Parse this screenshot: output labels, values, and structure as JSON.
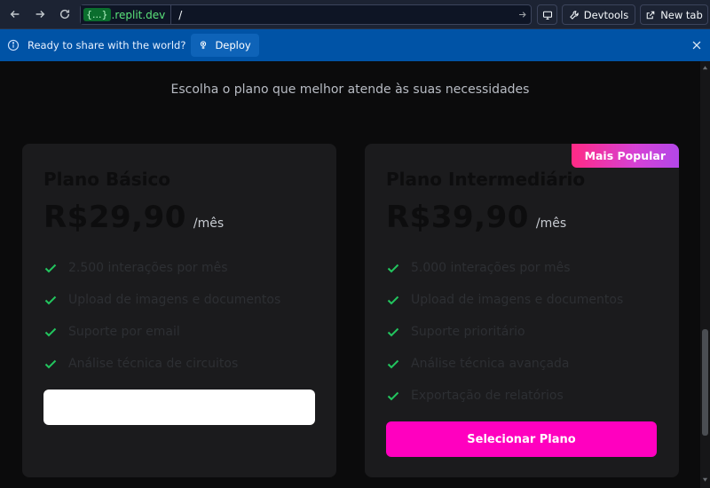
{
  "browser": {
    "url_badge": "{...}",
    "url_domain": ".replit.dev",
    "url_path": "/",
    "devtools_label": "Devtools",
    "new_tab_label": "New tab"
  },
  "banner": {
    "text": "Ready to share with the world?",
    "deploy_label": "Deploy"
  },
  "page": {
    "subtitle": "Escolha o plano que melhor atende às suas necessidades"
  },
  "plans": [
    {
      "name": "Plano Básico",
      "price": "R$29,90",
      "period": "/mês",
      "features": [
        "2.500 interações por mês",
        "Upload de imagens e documentos",
        "Suporte por email",
        "Análise técnica de circuitos"
      ],
      "button_label": ""
    },
    {
      "badge": "Mais Popular",
      "name": "Plano Intermediário",
      "price": "R$39,90",
      "period": "/mês",
      "features": [
        "5.000 interações por mês",
        "Upload de imagens e documentos",
        "Suporte prioritário",
        "Análise técnica avançada",
        "Exportação de relatórios"
      ],
      "button_label": "Selecionar Plano"
    }
  ],
  "colors": {
    "accent_pink": "#ff00bf",
    "check_green": "#22c55e",
    "banner_blue": "#0053a6",
    "card_bg": "#1b1b1d"
  },
  "icons": {
    "back": "arrow-left-icon",
    "forward": "arrow-right-icon",
    "reload": "reload-icon",
    "go": "arrow-right-icon",
    "screen": "monitor-icon",
    "devtools": "wrench-icon",
    "new_tab": "external-link-icon",
    "info": "info-icon",
    "deploy": "deploy-icon",
    "close": "close-icon",
    "check": "check-icon"
  }
}
